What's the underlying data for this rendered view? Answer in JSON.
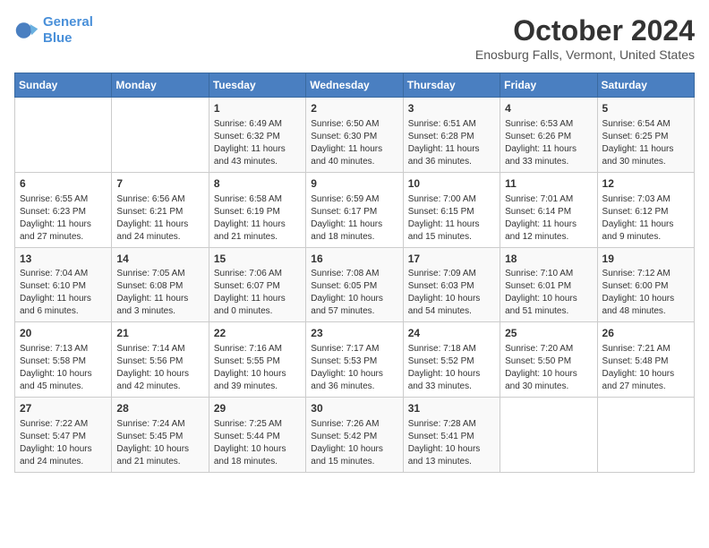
{
  "logo": {
    "line1": "General",
    "line2": "Blue"
  },
  "title": "October 2024",
  "location": "Enosburg Falls, Vermont, United States",
  "days_of_week": [
    "Sunday",
    "Monday",
    "Tuesday",
    "Wednesday",
    "Thursday",
    "Friday",
    "Saturday"
  ],
  "weeks": [
    [
      {
        "num": "",
        "detail": ""
      },
      {
        "num": "",
        "detail": ""
      },
      {
        "num": "1",
        "detail": "Sunrise: 6:49 AM\nSunset: 6:32 PM\nDaylight: 11 hours and 43 minutes."
      },
      {
        "num": "2",
        "detail": "Sunrise: 6:50 AM\nSunset: 6:30 PM\nDaylight: 11 hours and 40 minutes."
      },
      {
        "num": "3",
        "detail": "Sunrise: 6:51 AM\nSunset: 6:28 PM\nDaylight: 11 hours and 36 minutes."
      },
      {
        "num": "4",
        "detail": "Sunrise: 6:53 AM\nSunset: 6:26 PM\nDaylight: 11 hours and 33 minutes."
      },
      {
        "num": "5",
        "detail": "Sunrise: 6:54 AM\nSunset: 6:25 PM\nDaylight: 11 hours and 30 minutes."
      }
    ],
    [
      {
        "num": "6",
        "detail": "Sunrise: 6:55 AM\nSunset: 6:23 PM\nDaylight: 11 hours and 27 minutes."
      },
      {
        "num": "7",
        "detail": "Sunrise: 6:56 AM\nSunset: 6:21 PM\nDaylight: 11 hours and 24 minutes."
      },
      {
        "num": "8",
        "detail": "Sunrise: 6:58 AM\nSunset: 6:19 PM\nDaylight: 11 hours and 21 minutes."
      },
      {
        "num": "9",
        "detail": "Sunrise: 6:59 AM\nSunset: 6:17 PM\nDaylight: 11 hours and 18 minutes."
      },
      {
        "num": "10",
        "detail": "Sunrise: 7:00 AM\nSunset: 6:15 PM\nDaylight: 11 hours and 15 minutes."
      },
      {
        "num": "11",
        "detail": "Sunrise: 7:01 AM\nSunset: 6:14 PM\nDaylight: 11 hours and 12 minutes."
      },
      {
        "num": "12",
        "detail": "Sunrise: 7:03 AM\nSunset: 6:12 PM\nDaylight: 11 hours and 9 minutes."
      }
    ],
    [
      {
        "num": "13",
        "detail": "Sunrise: 7:04 AM\nSunset: 6:10 PM\nDaylight: 11 hours and 6 minutes."
      },
      {
        "num": "14",
        "detail": "Sunrise: 7:05 AM\nSunset: 6:08 PM\nDaylight: 11 hours and 3 minutes."
      },
      {
        "num": "15",
        "detail": "Sunrise: 7:06 AM\nSunset: 6:07 PM\nDaylight: 11 hours and 0 minutes."
      },
      {
        "num": "16",
        "detail": "Sunrise: 7:08 AM\nSunset: 6:05 PM\nDaylight: 10 hours and 57 minutes."
      },
      {
        "num": "17",
        "detail": "Sunrise: 7:09 AM\nSunset: 6:03 PM\nDaylight: 10 hours and 54 minutes."
      },
      {
        "num": "18",
        "detail": "Sunrise: 7:10 AM\nSunset: 6:01 PM\nDaylight: 10 hours and 51 minutes."
      },
      {
        "num": "19",
        "detail": "Sunrise: 7:12 AM\nSunset: 6:00 PM\nDaylight: 10 hours and 48 minutes."
      }
    ],
    [
      {
        "num": "20",
        "detail": "Sunrise: 7:13 AM\nSunset: 5:58 PM\nDaylight: 10 hours and 45 minutes."
      },
      {
        "num": "21",
        "detail": "Sunrise: 7:14 AM\nSunset: 5:56 PM\nDaylight: 10 hours and 42 minutes."
      },
      {
        "num": "22",
        "detail": "Sunrise: 7:16 AM\nSunset: 5:55 PM\nDaylight: 10 hours and 39 minutes."
      },
      {
        "num": "23",
        "detail": "Sunrise: 7:17 AM\nSunset: 5:53 PM\nDaylight: 10 hours and 36 minutes."
      },
      {
        "num": "24",
        "detail": "Sunrise: 7:18 AM\nSunset: 5:52 PM\nDaylight: 10 hours and 33 minutes."
      },
      {
        "num": "25",
        "detail": "Sunrise: 7:20 AM\nSunset: 5:50 PM\nDaylight: 10 hours and 30 minutes."
      },
      {
        "num": "26",
        "detail": "Sunrise: 7:21 AM\nSunset: 5:48 PM\nDaylight: 10 hours and 27 minutes."
      }
    ],
    [
      {
        "num": "27",
        "detail": "Sunrise: 7:22 AM\nSunset: 5:47 PM\nDaylight: 10 hours and 24 minutes."
      },
      {
        "num": "28",
        "detail": "Sunrise: 7:24 AM\nSunset: 5:45 PM\nDaylight: 10 hours and 21 minutes."
      },
      {
        "num": "29",
        "detail": "Sunrise: 7:25 AM\nSunset: 5:44 PM\nDaylight: 10 hours and 18 minutes."
      },
      {
        "num": "30",
        "detail": "Sunrise: 7:26 AM\nSunset: 5:42 PM\nDaylight: 10 hours and 15 minutes."
      },
      {
        "num": "31",
        "detail": "Sunrise: 7:28 AM\nSunset: 5:41 PM\nDaylight: 10 hours and 13 minutes."
      },
      {
        "num": "",
        "detail": ""
      },
      {
        "num": "",
        "detail": ""
      }
    ]
  ]
}
